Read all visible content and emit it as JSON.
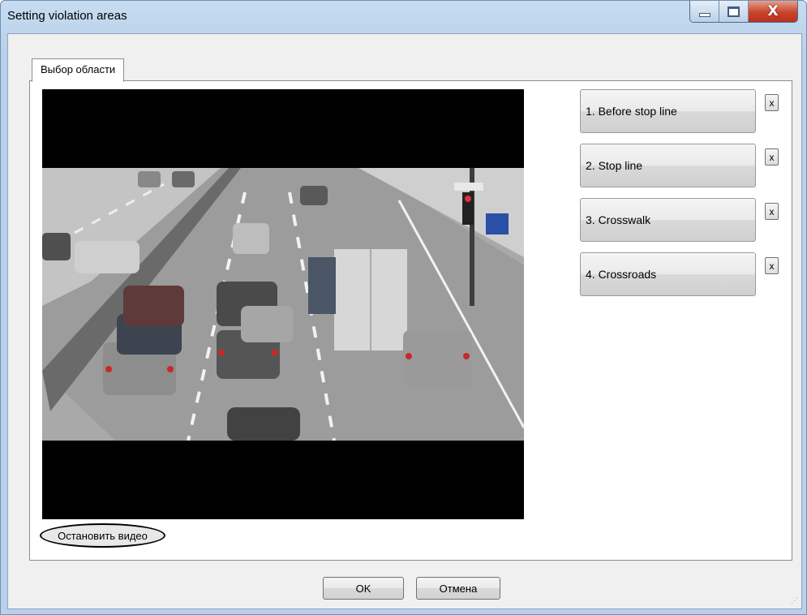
{
  "window": {
    "title": "Setting violation areas",
    "minimize_icon": "minimize-icon",
    "maximize_icon": "maximize-icon",
    "close_glyph": "X"
  },
  "tab": {
    "label": "Выбор области"
  },
  "video": {
    "description_icon": "video-frame",
    "stop_button": "Остановить видео"
  },
  "areas": [
    {
      "label": "1. Before stop line",
      "remove": "x"
    },
    {
      "label": "2. Stop line",
      "remove": "x"
    },
    {
      "label": "3. Crosswalk",
      "remove": "x"
    },
    {
      "label": "4. Crossroads",
      "remove": "x"
    }
  ],
  "footer": {
    "ok": "OK",
    "cancel": "Отмена"
  },
  "colors": {
    "title_bar": "#b9d1ea",
    "close_button": "#c8442a",
    "client_bg": "#f0f0f0"
  }
}
